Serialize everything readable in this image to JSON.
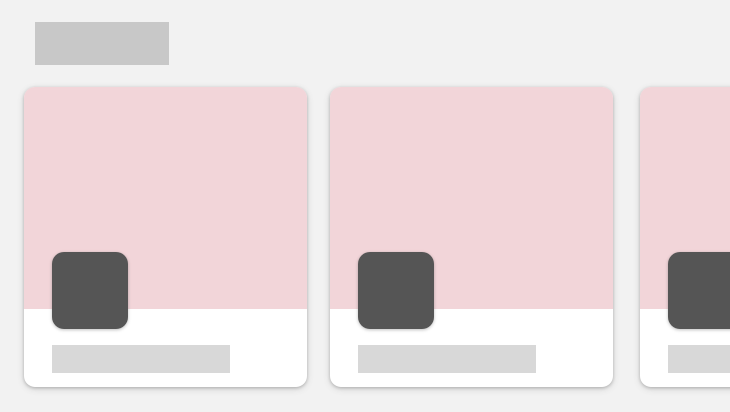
{
  "colors": {
    "background": "#f2f2f2",
    "title_placeholder": "#c8c8c8",
    "card_background": "#ffffff",
    "card_media": "#f2d5d9",
    "avatar": "#555555",
    "caption_placeholder": "#d8d8d8"
  },
  "cards": [
    {
      "avatar_icon": "app-icon-placeholder"
    },
    {
      "avatar_icon": "app-icon-placeholder"
    },
    {
      "avatar_icon": "app-icon-placeholder"
    }
  ]
}
